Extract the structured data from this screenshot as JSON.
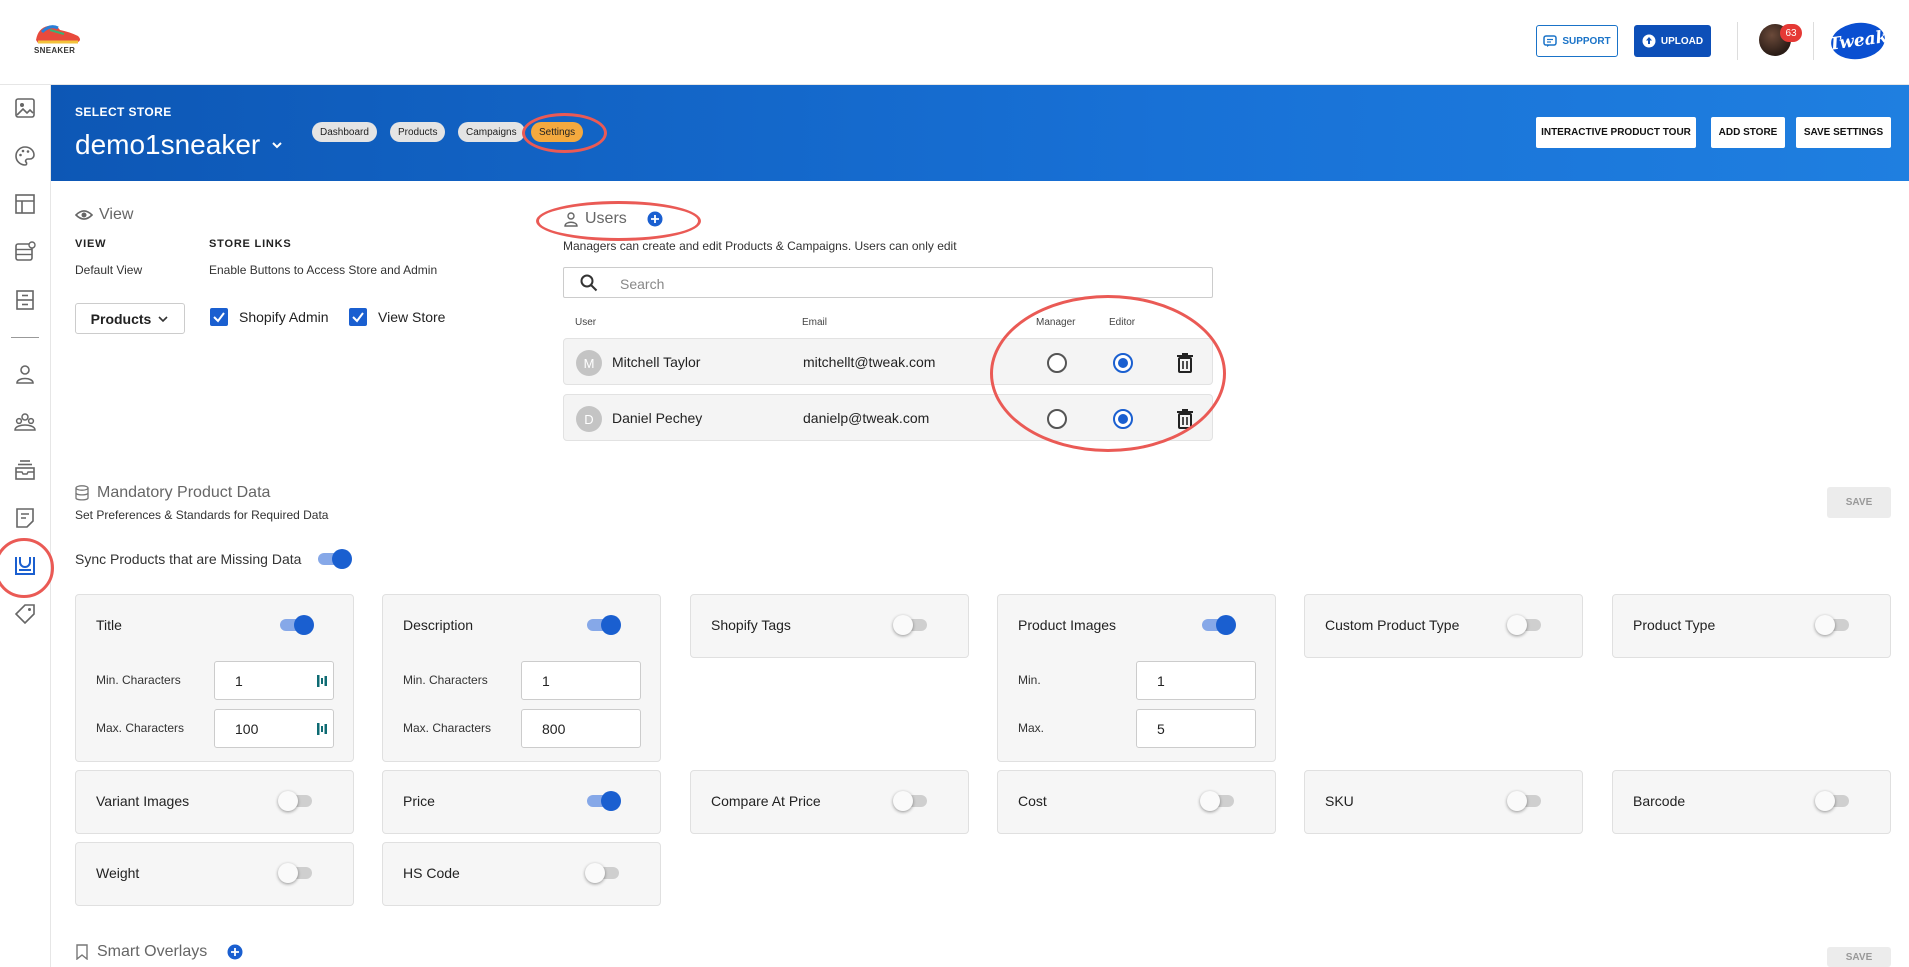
{
  "brand": {
    "logo_text": "SNEAKER",
    "tweak_logo": "Tweak"
  },
  "topbar": {
    "support_label": "SUPPORT",
    "upload_label": "UPLOAD",
    "notification_count": "63"
  },
  "sidebar": {
    "icons": [
      "image-icon",
      "palette-icon",
      "layout-icon",
      "database-icon",
      "archive-icon",
      "user-icon",
      "users-group-icon",
      "inbox-stack-icon",
      "document-icon",
      "store-settings-icon",
      "tag-icon"
    ],
    "active": "store-settings-icon"
  },
  "banner": {
    "select_store_label": "SELECT STORE",
    "store_name": "demo1sneaker",
    "tabs": [
      "Dashboard",
      "Products",
      "Campaigns",
      "Settings"
    ],
    "active_tab": "Settings",
    "buttons": {
      "tour": "INTERACTIVE PRODUCT TOUR",
      "add_store": "ADD STORE",
      "save_settings": "SAVE SETTINGS"
    }
  },
  "view_section": {
    "title": "View",
    "view_label": "VIEW",
    "view_desc": "Default View",
    "store_links_label": "STORE LINKS",
    "store_links_desc": "Enable Buttons to Access Store and Admin",
    "dropdown_value": "Products",
    "checkboxes": [
      {
        "label": "Shopify Admin",
        "checked": true
      },
      {
        "label": "View Store",
        "checked": true
      }
    ]
  },
  "users_section": {
    "title": "Users",
    "description": "Managers can create and edit Products & Campaigns. Users can only edit",
    "search_placeholder": "Search",
    "columns": {
      "user": "User",
      "email": "Email",
      "manager": "Manager",
      "editor": "Editor"
    },
    "rows": [
      {
        "initial": "M",
        "name": "Mitchell Taylor",
        "email": "mitchellt@tweak.com",
        "role": "Editor"
      },
      {
        "initial": "D",
        "name": "Daniel Pechey",
        "email": "danielp@tweak.com",
        "role": "Editor"
      }
    ]
  },
  "mandatory_section": {
    "title": "Mandatory Product Data",
    "description": "Set Preferences & Standards for Required Data",
    "save_label": "SAVE",
    "sync_label": "Sync Products that are Missing Data",
    "sync_on": true,
    "cards": [
      {
        "title": "Title",
        "on": true,
        "fields": [
          {
            "label": "Min. Characters",
            "value": "1"
          },
          {
            "label": "Max. Characters",
            "value": "100"
          }
        ]
      },
      {
        "title": "Description",
        "on": true,
        "fields": [
          {
            "label": "Min. Characters",
            "value": "1"
          },
          {
            "label": "Max. Characters",
            "value": "800"
          }
        ]
      },
      {
        "title": "Shopify Tags",
        "on": false
      },
      {
        "title": "Product Images",
        "on": true,
        "fields": [
          {
            "label": "Min.",
            "value": "1"
          },
          {
            "label": "Max.",
            "value": "5"
          }
        ]
      },
      {
        "title": "Custom Product Type",
        "on": false
      },
      {
        "title": "Product Type",
        "on": false
      },
      {
        "title": "Variant Images",
        "on": false
      },
      {
        "title": "Price",
        "on": true
      },
      {
        "title": "Compare At Price",
        "on": false
      },
      {
        "title": "Cost",
        "on": false
      },
      {
        "title": "SKU",
        "on": false
      },
      {
        "title": "Barcode",
        "on": false
      },
      {
        "title": "Weight",
        "on": false
      },
      {
        "title": "HS Code",
        "on": false
      }
    ]
  },
  "overlays_section": {
    "title": "Smart Overlays",
    "save_label": "SAVE"
  },
  "colors": {
    "brand_blue": "#1a5fd0",
    "banner_blue": "#1871d6",
    "active_tab": "#f4a93e",
    "annotation_red": "#ea5a55"
  }
}
